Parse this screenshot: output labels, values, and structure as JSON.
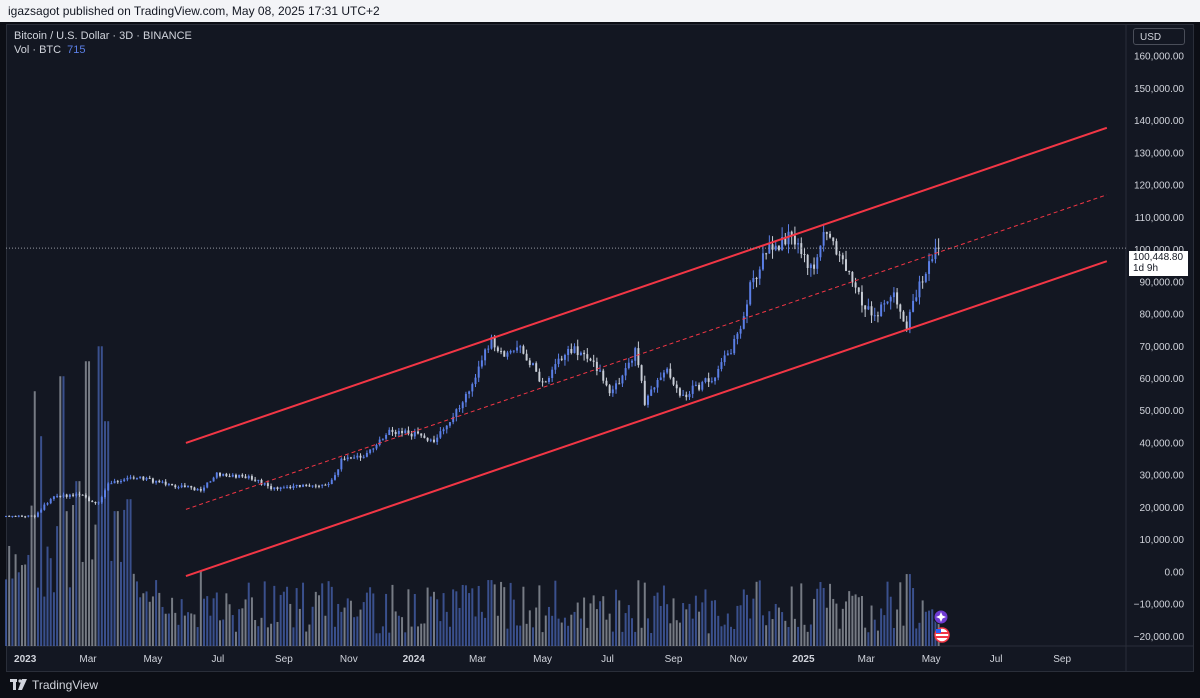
{
  "header": {
    "published": "igazsagot published on TradingView.com, May 08, 2025 17:31 UTC+2"
  },
  "legend": {
    "symbol": "Bitcoin / U.S. Dollar · 3D · BINANCE",
    "vol_label": "Vol · BTC",
    "vol_value": "715"
  },
  "currency_button": "USD",
  "price_label": {
    "price": "100,448.80",
    "countdown": "1d 9h"
  },
  "brand": "TradingView",
  "colors": {
    "up": "#5b7fe6",
    "down": "#c8cdd6",
    "channel": "#f23645",
    "background": "#131722"
  },
  "chart_data": {
    "type": "candlestick",
    "title": "Bitcoin / U.S. Dollar · 3D · BINANCE",
    "ylim": [
      -23000,
      170000
    ],
    "y_ticks": [
      -20000,
      -10000,
      0,
      10000,
      20000,
      30000,
      40000,
      50000,
      60000,
      70000,
      80000,
      90000,
      100000,
      110000,
      120000,
      130000,
      140000,
      150000,
      160000
    ],
    "y_tick_labels": [
      "−20,000.00",
      "−10,000.00",
      "0.00",
      "10,000.00",
      "20,000.00",
      "30,000.00",
      "40,000.00",
      "50,000.00",
      "60,000.00",
      "70,000.00",
      "80,000.00",
      "90,000.00",
      "100,000.00",
      "110,000.00",
      "120,000.00",
      "130,000.00",
      "140,000.00",
      "150,000.00",
      "160,000.00"
    ],
    "x_ticks": [
      {
        "label": "2023",
        "date": "2023-01-01",
        "bold": true
      },
      {
        "label": "Mar",
        "date": "2023-03-01"
      },
      {
        "label": "May",
        "date": "2023-05-01"
      },
      {
        "label": "Jul",
        "date": "2023-07-01"
      },
      {
        "label": "Sep",
        "date": "2023-09-01"
      },
      {
        "label": "Nov",
        "date": "2023-11-01"
      },
      {
        "label": "2024",
        "date": "2024-01-01",
        "bold": true
      },
      {
        "label": "Mar",
        "date": "2024-03-01"
      },
      {
        "label": "May",
        "date": "2024-05-01"
      },
      {
        "label": "Jul",
        "date": "2024-07-01"
      },
      {
        "label": "Sep",
        "date": "2024-09-01"
      },
      {
        "label": "Nov",
        "date": "2024-11-01"
      },
      {
        "label": "2025",
        "date": "2025-01-01",
        "bold": true
      },
      {
        "label": "Mar",
        "date": "2025-03-01"
      },
      {
        "label": "May",
        "date": "2025-05-01"
      },
      {
        "label": "Jul",
        "date": "2025-07-01"
      },
      {
        "label": "Sep",
        "date": "2025-09-01"
      }
    ],
    "xlim": [
      "2022-12-14",
      "2025-10-31"
    ],
    "last_price": 100448.8,
    "price_path": [
      [
        "2022-12-14",
        17200
      ],
      [
        "2023-01-10",
        17400
      ],
      [
        "2023-01-25",
        22800
      ],
      [
        "2023-02-20",
        24300
      ],
      [
        "2023-03-10",
        20500
      ],
      [
        "2023-03-20",
        27500
      ],
      [
        "2023-04-15",
        29500
      ],
      [
        "2023-05-15",
        27000
      ],
      [
        "2023-06-15",
        25500
      ],
      [
        "2023-07-01",
        30500
      ],
      [
        "2023-08-01",
        29300
      ],
      [
        "2023-08-18",
        26200
      ],
      [
        "2023-09-15",
        26500
      ],
      [
        "2023-10-15",
        27500
      ],
      [
        "2023-10-25",
        34500
      ],
      [
        "2023-11-15",
        36500
      ],
      [
        "2023-12-10",
        43500
      ],
      [
        "2024-01-01",
        42800
      ],
      [
        "2024-01-20",
        40500
      ],
      [
        "2024-02-15",
        51500
      ],
      [
        "2024-03-13",
        72000
      ],
      [
        "2024-03-25",
        67500
      ],
      [
        "2024-04-10",
        70500
      ],
      [
        "2024-05-01",
        58000
      ],
      [
        "2024-05-25",
        69000
      ],
      [
        "2024-06-10",
        68500
      ],
      [
        "2024-07-05",
        55500
      ],
      [
        "2024-07-28",
        68500
      ],
      [
        "2024-08-05",
        53000
      ],
      [
        "2024-08-25",
        62500
      ],
      [
        "2024-09-07",
        54000
      ],
      [
        "2024-10-10",
        61000
      ],
      [
        "2024-10-30",
        72000
      ],
      [
        "2024-11-12",
        88500
      ],
      [
        "2024-11-25",
        98000
      ],
      [
        "2024-12-17",
        104500
      ],
      [
        "2025-01-10",
        93500
      ],
      [
        "2025-01-22",
        106500
      ],
      [
        "2025-02-05",
        97500
      ],
      [
        "2025-02-25",
        84000
      ],
      [
        "2025-03-10",
        79000
      ],
      [
        "2025-03-25",
        87500
      ],
      [
        "2025-04-08",
        77000
      ],
      [
        "2025-04-25",
        94000
      ],
      [
        "2025-05-08",
        100448
      ]
    ],
    "channel": {
      "upper": [
        [
          "2023-06-01",
          40000
        ],
        [
          "2025-10-13",
          137800
        ]
      ],
      "middle": [
        [
          "2023-06-01",
          19400
        ],
        [
          "2025-10-13",
          117000
        ]
      ],
      "lower": [
        [
          "2023-06-01",
          -1300
        ],
        [
          "2025-10-13",
          96400
        ]
      ]
    },
    "volume_scale": {
      "baseline": -23000,
      "max_value_height": 10000
    },
    "volume_spikes": [
      [
        "2023-01-10",
        0.85
      ],
      [
        "2023-01-16",
        0.7
      ],
      [
        "2023-02-05",
        0.9
      ],
      [
        "2023-02-20",
        0.55
      ],
      [
        "2023-03-01",
        0.95
      ],
      [
        "2023-03-13",
        1.0
      ],
      [
        "2023-03-19",
        0.75
      ],
      [
        "2023-03-28",
        0.45
      ],
      [
        "2023-06-15",
        0.25
      ],
      [
        "2024-03-13",
        0.22
      ],
      [
        "2025-04-10",
        0.24
      ]
    ]
  }
}
